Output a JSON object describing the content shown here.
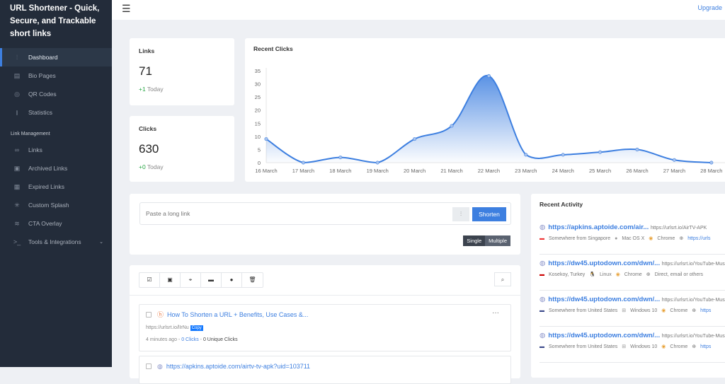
{
  "sidebar": {
    "brand": "URL Shortener - Quick, Secure, and Trackable short links",
    "items": [
      {
        "label": "Dashboard",
        "icon": "sliders-icon"
      },
      {
        "label": "Bio Pages",
        "icon": "layout-icon"
      },
      {
        "label": "QR Codes",
        "icon": "aperture-icon"
      },
      {
        "label": "Statistics",
        "icon": "bar-chart-icon"
      }
    ],
    "section": "Link Management",
    "items2": [
      {
        "label": "Links",
        "icon": "link-icon"
      },
      {
        "label": "Archived Links",
        "icon": "briefcase-icon"
      },
      {
        "label": "Expired Links",
        "icon": "calendar-icon"
      },
      {
        "label": "Custom Splash",
        "icon": "loader-icon"
      },
      {
        "label": "CTA Overlay",
        "icon": "layers-icon"
      },
      {
        "label": "Tools & Integrations",
        "icon": "terminal-icon"
      }
    ]
  },
  "header": {
    "upgrade": "Upgrade"
  },
  "stats": {
    "links": {
      "title": "Links",
      "value": "71",
      "delta": "+1",
      "delta_suffix": " Today"
    },
    "clicks": {
      "title": "Clicks",
      "value": "630",
      "delta": "+0",
      "delta_suffix": " Today"
    }
  },
  "chart_title": "Recent Clicks",
  "chart_data": {
    "type": "area",
    "categories": [
      "16 March",
      "17 March",
      "18 March",
      "19 March",
      "20 March",
      "21 March",
      "22 March",
      "23 March",
      "24 March",
      "25 March",
      "26 March",
      "27 March",
      "28 March"
    ],
    "values": [
      9,
      0,
      2,
      0,
      9,
      14,
      33,
      3,
      3,
      4,
      5,
      1,
      0
    ],
    "ylim": [
      0,
      35
    ],
    "yticks": [
      0,
      5,
      10,
      15,
      20,
      25,
      30,
      35
    ],
    "color": "#3d7fe0",
    "grid": false
  },
  "shorten": {
    "placeholder": "Paste a long link",
    "button": "Shorten",
    "single": "Single",
    "multiple": "Multiple"
  },
  "links_list": [
    {
      "title": "How To Shorten a URL + Benefits, Use Cases &...",
      "short": "https://urlsrt.io/lIrNu",
      "copy": "Copy",
      "time": "4 minutes ago",
      "clicks": "0 Clicks",
      "unique": "0 Unique Clicks"
    },
    {
      "title": "https://apkins.aptoide.com/airtv-tv-apk?uid=103711"
    }
  ],
  "activity": {
    "title": "Recent Activity",
    "items": [
      {
        "url": "https://apkins.aptoide.com/air...",
        "short": "https://urlsrt.io/AirTV-APK",
        "location": "Somewhere from Singapore",
        "os": "Mac OS X",
        "browser": "Chrome",
        "referrer": "https://urls"
      },
      {
        "url": "https://dw45.uptodown.com/dwn/...",
        "short": "https://urlsrt.io/YouTube-Mus",
        "location": "Kosekoy, Turkey",
        "os": "Linux",
        "browser": "Chrome",
        "referrer": "Direct, email or others"
      },
      {
        "url": "https://dw45.uptodown.com/dwn/...",
        "short": "https://urlsrt.io/YouTube-Mus",
        "location": "Somewhere from United States",
        "os": "Windows 10",
        "browser": "Chrome",
        "referrer": "https"
      },
      {
        "url": "https://dw45.uptodown.com/dwn/...",
        "short": "https://urlsrt.io/YouTube-Mus",
        "location": "Somewhere from United States",
        "os": "Windows 10",
        "browser": "Chrome",
        "referrer": "https"
      }
    ]
  }
}
